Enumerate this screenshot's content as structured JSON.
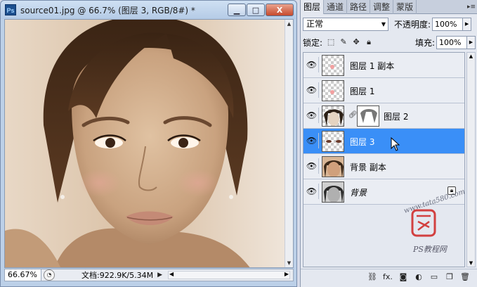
{
  "document_window": {
    "title": "source01.jpg @ 66.7% (图层 3, RGB/8#) *",
    "app_icon_label": "Ps",
    "buttons": {
      "minimize": "▁",
      "maximize": "□",
      "close": "X"
    },
    "status": {
      "zoom": "66.67%",
      "doc_info": "文档:922.9K/5.34M"
    }
  },
  "layers_panel": {
    "tabs": [
      {
        "label": "图层",
        "active": true
      },
      {
        "label": "通道",
        "active": false
      },
      {
        "label": "路径",
        "active": false
      },
      {
        "label": "调整",
        "active": false
      },
      {
        "label": "蒙版",
        "active": false
      }
    ],
    "blend_mode": "正常",
    "opacity_label": "不透明度:",
    "opacity_value": "100%",
    "lock_label": "锁定:",
    "fill_label": "填充:",
    "fill_value": "100%",
    "layers": [
      {
        "name": "图层 1 副本",
        "visible": true,
        "selected": false,
        "thumb": "transparent-pink"
      },
      {
        "name": "图层 1",
        "visible": true,
        "selected": false,
        "thumb": "transparent-pink"
      },
      {
        "name": "图层 2",
        "visible": true,
        "selected": false,
        "thumb": "hair-mask"
      },
      {
        "name": "图层 3",
        "visible": true,
        "selected": true,
        "thumb": "eyes"
      },
      {
        "name": "背景 副本",
        "visible": true,
        "selected": false,
        "thumb": "face-color"
      },
      {
        "name": "背景",
        "visible": true,
        "selected": false,
        "thumb": "face-gray",
        "locked": true
      }
    ],
    "footer_icons": [
      "link-icon",
      "fx-icon",
      "mask-icon",
      "adjustment-icon",
      "group-icon",
      "new-layer-icon",
      "trash-icon"
    ],
    "footer_labels": {
      "fx": "fx."
    }
  },
  "watermark": {
    "site": "PS教程网",
    "url": "www.tata580.com"
  },
  "colors": {
    "selected_layer": "#3a8ff7",
    "sepia_skin": "#c9a888"
  }
}
